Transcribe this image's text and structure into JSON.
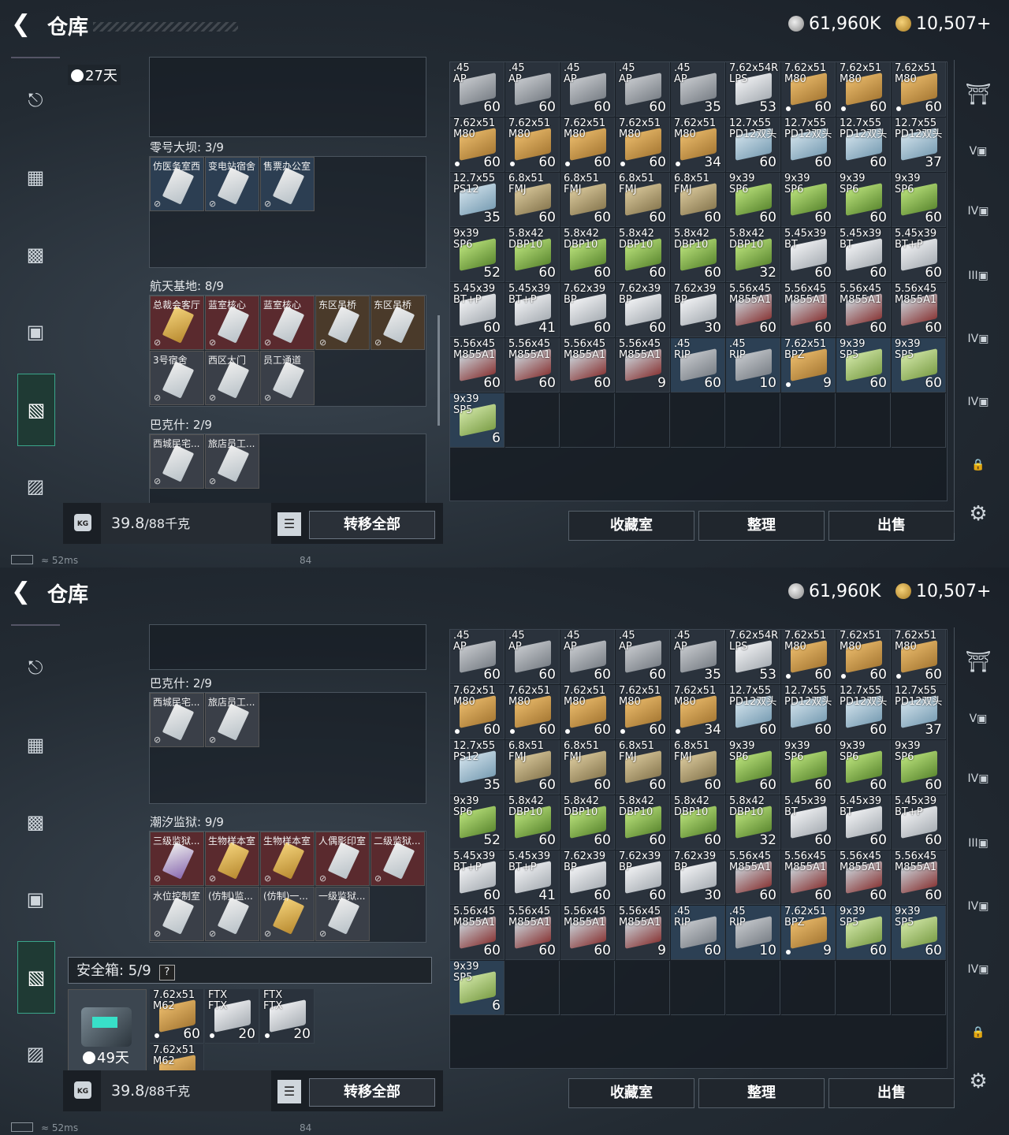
{
  "header": {
    "title": "仓库",
    "silver": "61,960K",
    "gold": "10,507+"
  },
  "status": {
    "ping": "52ms",
    "fps": "84"
  },
  "left": {
    "weight_current": "39.8",
    "weight_max": "/88千克",
    "transfer_all": "转移全部",
    "kg": "KG",
    "top_timer": "27天",
    "safebox_timer": "49天"
  },
  "actions": {
    "collection": "收藏室",
    "sort": "整理",
    "sell": "出售"
  },
  "rail_labels": [
    "V",
    "IV",
    "III",
    "IV",
    "IV"
  ],
  "sections_top": [
    {
      "title": "零号大坝: 3/9",
      "cards": [
        "仿医务室西",
        "变电站宿舍",
        "售票办公室"
      ]
    },
    {
      "title": "航天基地: 8/9",
      "cards": [
        "总裁会客厅",
        "蓝室核心",
        "蓝室核心",
        "东区吊桥",
        "东区吊桥",
        "3号宿舍",
        "西区大门",
        "员工通道"
      ]
    },
    {
      "title": "巴克什: 2/9",
      "cards": [
        "西城民宅...",
        "旅店员工..."
      ]
    }
  ],
  "sections_bottom": [
    {
      "title": "巴克什: 2/9",
      "cards": [
        "西城民宅...",
        "旅店员工..."
      ]
    },
    {
      "title": "潮汐监狱: 9/9",
      "cards": [
        "三级监狱...",
        "生物样本室",
        "生物样本室",
        "人偶影印室",
        "二级监狱...",
        "水位控制室",
        "(仿制)监...",
        "(仿制)一...",
        "一级监狱..."
      ]
    }
  ],
  "safebox": {
    "label": "安全箱: 5/9",
    "help": "?",
    "items": [
      {
        "cal": "7.62x51\nM62",
        "count": "60"
      },
      {
        "cal": "FTX\nFTX",
        "count": "20"
      },
      {
        "cal": "FTX\nFTX",
        "count": "20"
      },
      {
        "cal": "7.62x51\nM62",
        "count": ""
      }
    ]
  },
  "ammo": [
    {
      "cal": ".45\nAP",
      "count": "60",
      "color": "b-grey"
    },
    {
      "cal": ".45\nAP",
      "count": "60",
      "color": "b-grey"
    },
    {
      "cal": ".45\nAP",
      "count": "60",
      "color": "b-grey"
    },
    {
      "cal": ".45\nAP",
      "count": "60",
      "color": "b-grey"
    },
    {
      "cal": ".45\nAP",
      "count": "35",
      "color": "b-grey"
    },
    {
      "cal": "7.62x54R\nLPS",
      "count": "53",
      "color": "b-white"
    },
    {
      "cal": "7.62x51\nM80",
      "count": "60",
      "color": "b-yellow",
      "dot": true
    },
    {
      "cal": "7.62x51\nM80",
      "count": "60",
      "color": "b-yellow",
      "dot": true
    },
    {
      "cal": "7.62x51\nM80",
      "count": "60",
      "color": "b-yellow",
      "dot": true
    },
    {
      "cal": "7.62x51\nM80",
      "count": "60",
      "color": "b-yellow",
      "dot": true
    },
    {
      "cal": "7.62x51\nM80",
      "count": "60",
      "color": "b-yellow",
      "dot": true
    },
    {
      "cal": "7.62x51\nM80",
      "count": "60",
      "color": "b-yellow",
      "dot": true
    },
    {
      "cal": "7.62x51\nM80",
      "count": "60",
      "color": "b-yellow",
      "dot": true
    },
    {
      "cal": "7.62x51\nM80",
      "count": "34",
      "color": "b-yellow",
      "dot": true
    },
    {
      "cal": "12.7x55\nPD12双头",
      "count": "60",
      "color": "b-blue"
    },
    {
      "cal": "12.7x55\nPD12双头",
      "count": "60",
      "color": "b-blue"
    },
    {
      "cal": "12.7x55\nPD12双头",
      "count": "60",
      "color": "b-blue"
    },
    {
      "cal": "12.7x55\nPD12双头",
      "count": "37",
      "color": "b-blue"
    },
    {
      "cal": "12.7x55\nPS12",
      "count": "35",
      "color": "b-blue"
    },
    {
      "cal": "6.8x51\nFMJ",
      "count": "60",
      "color": "b-tan"
    },
    {
      "cal": "6.8x51\nFMJ",
      "count": "60",
      "color": "b-tan"
    },
    {
      "cal": "6.8x51\nFMJ",
      "count": "60",
      "color": "b-tan"
    },
    {
      "cal": "6.8x51\nFMJ",
      "count": "60",
      "color": "b-tan"
    },
    {
      "cal": "9x39\nSP6",
      "count": "60",
      "color": "b-green"
    },
    {
      "cal": "9x39\nSP6",
      "count": "60",
      "color": "b-green"
    },
    {
      "cal": "9x39\nSP6",
      "count": "60",
      "color": "b-green"
    },
    {
      "cal": "9x39\nSP6",
      "count": "60",
      "color": "b-green"
    },
    {
      "cal": "9x39\nSP6",
      "count": "52",
      "color": "b-green"
    },
    {
      "cal": "5.8x42\nDBP10",
      "count": "60",
      "color": "b-green"
    },
    {
      "cal": "5.8x42\nDBP10",
      "count": "60",
      "color": "b-green"
    },
    {
      "cal": "5.8x42\nDBP10",
      "count": "60",
      "color": "b-green"
    },
    {
      "cal": "5.8x42\nDBP10",
      "count": "60",
      "color": "b-green"
    },
    {
      "cal": "5.8x42\nDBP10",
      "count": "32",
      "color": "b-green"
    },
    {
      "cal": "5.45x39\nBT",
      "count": "60",
      "color": "b-white"
    },
    {
      "cal": "5.45x39\nBT",
      "count": "60",
      "color": "b-white"
    },
    {
      "cal": "5.45x39\nBT+P",
      "count": "60",
      "color": "b-white"
    },
    {
      "cal": "5.45x39\nBT+P",
      "count": "60",
      "color": "b-white"
    },
    {
      "cal": "5.45x39\nBT+P",
      "count": "41",
      "color": "b-white"
    },
    {
      "cal": "7.62x39\nBP",
      "count": "60",
      "color": "b-white"
    },
    {
      "cal": "7.62x39\nBP",
      "count": "60",
      "color": "b-white"
    },
    {
      "cal": "7.62x39\nBP",
      "count": "30",
      "color": "b-white"
    },
    {
      "cal": "5.56x45\nM855A1",
      "count": "60",
      "color": "b-red"
    },
    {
      "cal": "5.56x45\nM855A1",
      "count": "60",
      "color": "b-red"
    },
    {
      "cal": "5.56x45\nM855A1",
      "count": "60",
      "color": "b-red"
    },
    {
      "cal": "5.56x45\nM855A1",
      "count": "60",
      "color": "b-red"
    },
    {
      "cal": "5.56x45\nM855A1",
      "count": "60",
      "color": "b-red"
    },
    {
      "cal": "5.56x45\nM855A1",
      "count": "60",
      "color": "b-red"
    },
    {
      "cal": "5.56x45\nM855A1",
      "count": "60",
      "color": "b-red"
    },
    {
      "cal": "5.56x45\nM855A1",
      "count": "9",
      "color": "b-red"
    },
    {
      "cal": ".45\nRIP",
      "count": "60",
      "color": "b-grey",
      "hl": true
    },
    {
      "cal": ".45\nRIP",
      "count": "10",
      "color": "b-grey",
      "hl": true
    },
    {
      "cal": "7.62x51\nBPZ",
      "count": "9",
      "color": "b-yellow",
      "hl": true,
      "dot": true
    },
    {
      "cal": "9x39\nSP5",
      "count": "60",
      "color": "b-lightgreen",
      "hl": true
    },
    {
      "cal": "9x39\nSP5",
      "count": "60",
      "color": "b-lightgreen",
      "hl": true
    },
    {
      "cal": "9x39\nSP5",
      "count": "6",
      "color": "b-lightgreen",
      "hl": true
    }
  ]
}
